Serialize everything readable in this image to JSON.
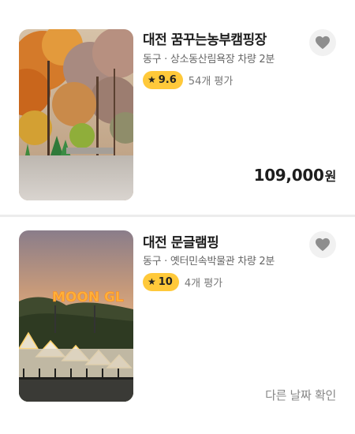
{
  "listings": [
    {
      "title": "대전 꿈꾸는농부캠핑장",
      "location": "동구 · 상소동산림욕장 차량 2분",
      "rating": "9.6",
      "reviews": "54개 평가",
      "price": "109,000",
      "price_unit": "원",
      "photo_icon": "autumn-forest-photo"
    },
    {
      "title": "대전 문글램핑",
      "location": "동구 · 옛터민속박물관 차량 2분",
      "rating": "10",
      "reviews": "4개 평가",
      "status": "다른 날짜 확인",
      "photo_icon": "glamping-night-photo",
      "sign_text": "MOON GL"
    }
  ],
  "icons": {
    "star": "★",
    "favorite": "heart-icon"
  },
  "colors": {
    "rating_badge": "#ffc93a",
    "favorite_button": "#f1f1f1",
    "heart": "#8e8e8e"
  }
}
